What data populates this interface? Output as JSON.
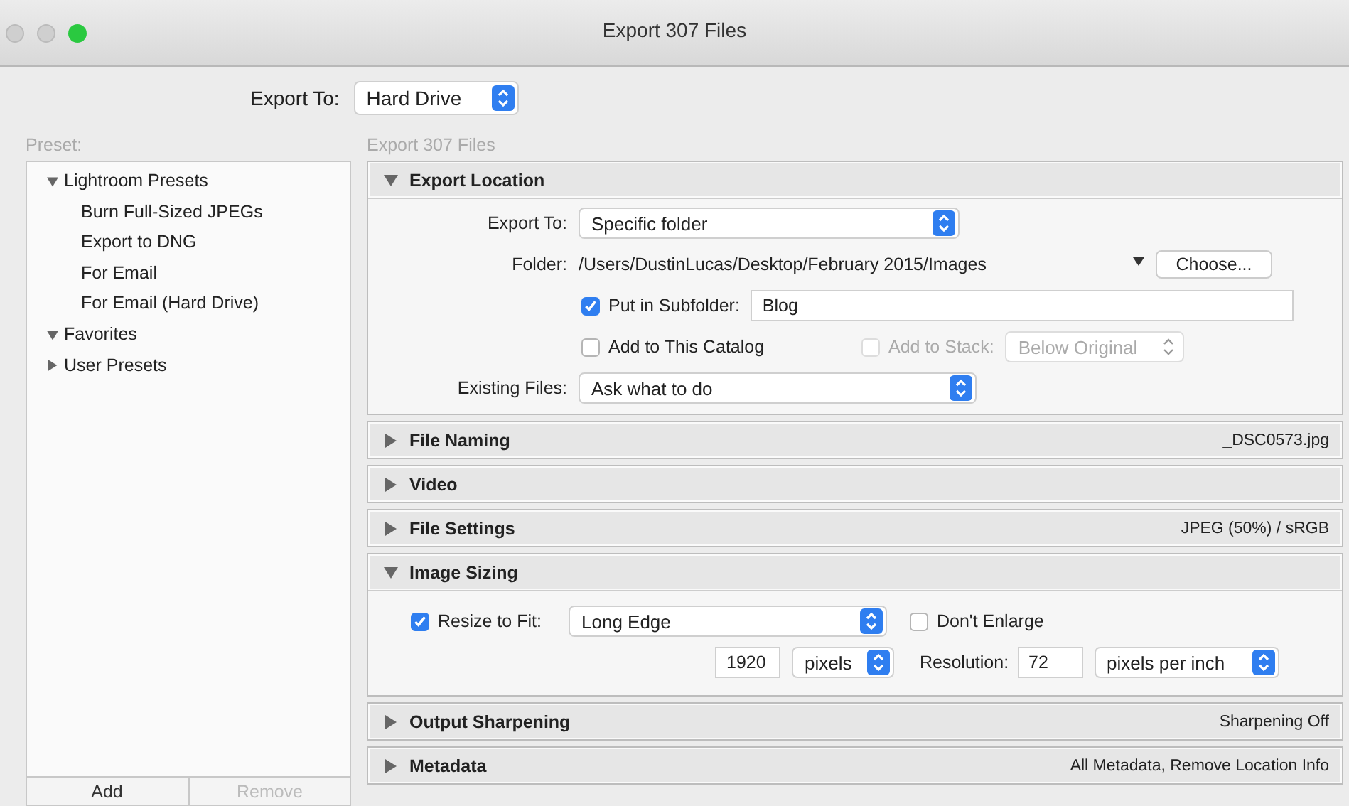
{
  "window": {
    "title": "Export 307 Files"
  },
  "export_to": {
    "label": "Export To:",
    "value": "Hard Drive"
  },
  "preset_label": "Preset:",
  "files_label": "Export 307 Files",
  "presets": [
    {
      "label": "Lightroom Presets",
      "expanded": true,
      "children": [
        {
          "label": "Burn Full-Sized JPEGs"
        },
        {
          "label": "Export to DNG"
        },
        {
          "label": "For Email"
        },
        {
          "label": "For Email (Hard Drive)"
        }
      ]
    },
    {
      "label": "Favorites",
      "expanded": true
    },
    {
      "label": "User Presets",
      "expanded": false
    }
  ],
  "preset_buttons": [
    {
      "label": "Add",
      "disabled": false
    },
    {
      "label": "Remove",
      "disabled": true
    }
  ],
  "sections": [
    {
      "kind": "location",
      "title": "Export Location",
      "expanded": true,
      "export_to": {
        "label": "Export To:",
        "value": "Specific folder"
      },
      "folder": {
        "label": "Folder:",
        "path": "/Users/DustinLucas/Desktop/February 2015/Images",
        "button": "Choose..."
      },
      "subfolder": {
        "label": "Put in Subfolder:",
        "checked": true,
        "value": "Blog"
      },
      "catalog": {
        "label": "Add to This Catalog",
        "checked": false
      },
      "stack": {
        "label": "Add to Stack:",
        "checked": false,
        "disabled": true,
        "value": "Below Original"
      },
      "existing": {
        "label": "Existing Files:",
        "value": "Ask what to do"
      }
    },
    {
      "kind": "summary",
      "title": "File Naming",
      "expanded": false,
      "summary": "_DSC0573.jpg"
    },
    {
      "kind": "summary",
      "title": "Video",
      "expanded": false
    },
    {
      "kind": "summary",
      "title": "File Settings",
      "expanded": false,
      "summary": "JPEG (50%) / sRGB"
    },
    {
      "kind": "sizing",
      "title": "Image Sizing",
      "expanded": true,
      "resize": {
        "label": "Resize to Fit:",
        "checked": true,
        "value": "Long Edge"
      },
      "enlarge": {
        "label": "Don't Enlarge",
        "checked": false
      },
      "size": {
        "value": "1920",
        "unit": "pixels"
      },
      "resolution": {
        "label": "Resolution:",
        "value": "72",
        "unit": "pixels per inch"
      }
    },
    {
      "kind": "summary",
      "title": "Output Sharpening",
      "expanded": false,
      "summary": "Sharpening Off"
    },
    {
      "kind": "summary",
      "title": "Metadata",
      "expanded": false,
      "summary": "All Metadata, Remove Location Info"
    }
  ]
}
